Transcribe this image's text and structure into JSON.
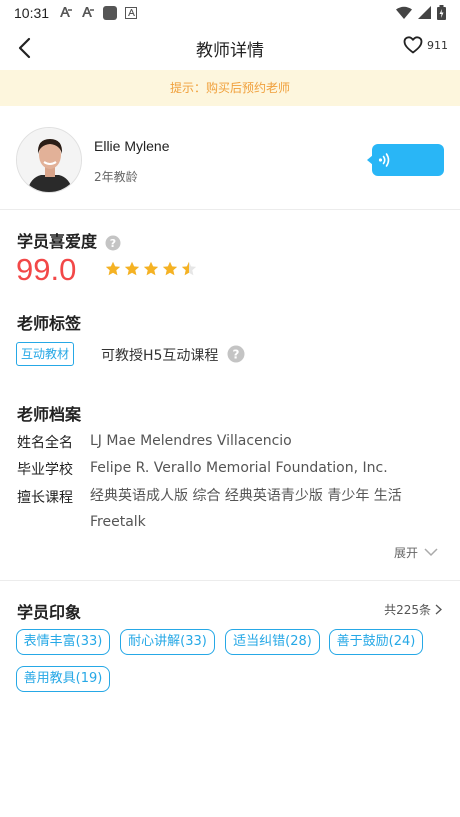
{
  "status_bar": {
    "time": "10:31"
  },
  "header": {
    "title": "教师详情",
    "favorite_count": "911"
  },
  "notice": {
    "text": "提示：购买后预约老师"
  },
  "teacher": {
    "name": "Ellie Mylene",
    "experience": "2年教龄"
  },
  "rating": {
    "title": "学员喜爱度",
    "score": "99.0",
    "stars": 4.5
  },
  "tags": {
    "title": "老师标签",
    "badge": "互动教材",
    "text": "可教授H5互动课程"
  },
  "profile": {
    "title": "老师档案",
    "full_name_label": "姓名全名",
    "full_name_value": "LJ Mae Melendres Villacencio",
    "school_label": "毕业学校",
    "school_value": "Felipe R. Verallo Memorial Foundation, Inc.",
    "courses_label": "擅长课程",
    "courses_value": "经典英语成人版 综合 经典英语青少版 青少年 生活 Freetalk",
    "expand_label": "展开"
  },
  "impressions": {
    "title": "学员印象",
    "total": "共225条",
    "items": [
      "表情丰富(33)",
      "耐心讲解(33)",
      "适当纠错(28)",
      "善于鼓励(24)",
      "善用教具(19)"
    ]
  },
  "colors": {
    "accent": "#26a8e6",
    "score": "#f24848",
    "notice_bg": "#fdf6dd",
    "notice_text": "#f0a03c",
    "star": "#f5b223"
  }
}
